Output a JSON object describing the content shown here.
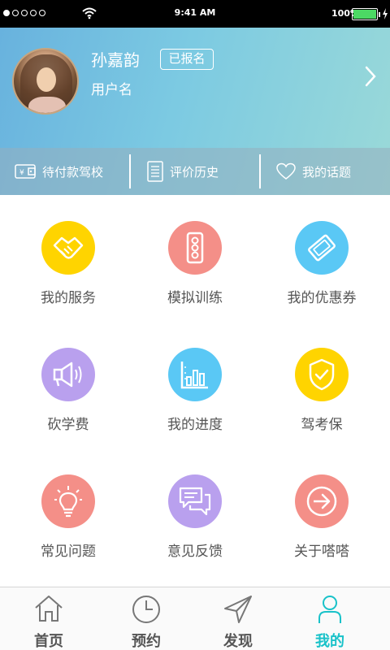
{
  "status_bar": {
    "time": "9:41 AM",
    "battery": "100%"
  },
  "profile": {
    "name": "孙嘉韵",
    "badge": "已报名",
    "subtitle": "用户名"
  },
  "shortcuts": [
    {
      "label": "待付款驾校",
      "icon": "wallet-icon"
    },
    {
      "label": "评价历史",
      "icon": "list-document-icon"
    },
    {
      "label": "我的话题",
      "icon": "heart-icon"
    }
  ],
  "grid": [
    {
      "label": "我的服务",
      "icon": "handshake-icon",
      "color": "#ffd400"
    },
    {
      "label": "模拟训练",
      "icon": "traffic-light-icon",
      "color": "#f48f88"
    },
    {
      "label": "我的优惠券",
      "icon": "ticket-icon",
      "color": "#5ac8f5"
    },
    {
      "label": "砍学费",
      "icon": "megaphone-icon",
      "color": "#b9a0ee"
    },
    {
      "label": "我的进度",
      "icon": "bar-chart-icon",
      "color": "#5ac8f5"
    },
    {
      "label": "驾考保",
      "icon": "shield-check-icon",
      "color": "#ffd400"
    },
    {
      "label": "常见问题",
      "icon": "lightbulb-icon",
      "color": "#f48f88"
    },
    {
      "label": "意见反馈",
      "icon": "chat-bubbles-icon",
      "color": "#b9a0ee"
    },
    {
      "label": "关于嗒嗒",
      "icon": "arrow-circle-icon",
      "color": "#f48f88"
    }
  ],
  "tabs": [
    {
      "label": "首页",
      "icon": "home-icon",
      "active": false
    },
    {
      "label": "预约",
      "icon": "clock-icon",
      "active": false
    },
    {
      "label": "发现",
      "icon": "send-icon",
      "active": false
    },
    {
      "label": "我的",
      "icon": "person-icon",
      "active": true
    }
  ],
  "colors": {
    "active_tab": "#19c2c9",
    "header_start": "#68b2de",
    "header_end": "#9ad9d8"
  }
}
